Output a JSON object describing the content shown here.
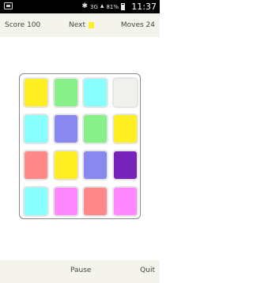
{
  "status_bar": {
    "network": "3G",
    "battery": "81%",
    "time": "11:37",
    "icons": [
      "notification-icon",
      "bluetooth-icon",
      "signal-icon",
      "battery-icon"
    ]
  },
  "header": {
    "score_label": "Score 100",
    "next_label": "Next",
    "next_color": "#ffee22",
    "moves_label": "Moves 24"
  },
  "board": {
    "rows": 4,
    "cols": 4,
    "tiles": [
      [
        "#ffee22",
        "#88f088",
        "#88ffff",
        "#f0f0ec"
      ],
      [
        "#88ffff",
        "#8888ee",
        "#88f088",
        "#ffee22"
      ],
      [
        "#ff8888",
        "#ffee22",
        "#8888ee",
        "#7722bb"
      ],
      [
        "#88ffff",
        "#ff88ff",
        "#ff8888",
        "#ff88ff"
      ]
    ]
  },
  "footer": {
    "pause_label": "Pause",
    "quit_label": "Quit"
  }
}
